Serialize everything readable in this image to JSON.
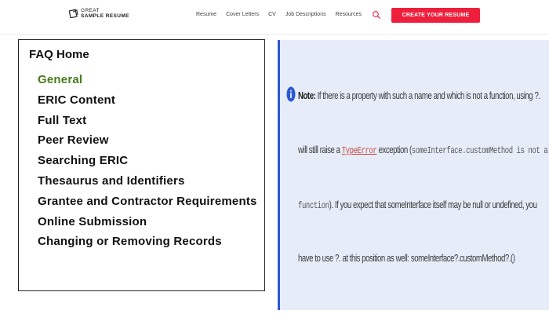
{
  "header": {
    "logo_line1": "GREAT",
    "logo_line2": "SAMPLE RESUME",
    "nav": [
      "Resume",
      "Cover Letters",
      "CV",
      "Job Descriptions",
      "Resources"
    ],
    "cta_label": "CREATE YOUR RESUME",
    "accent_color": "#ee1f3c"
  },
  "faq": {
    "title": "FAQ Home",
    "items": [
      "General",
      "ERIC Content",
      "Full Text",
      "Peer Review",
      "Searching ERIC",
      "Thesaurus and Identifiers",
      "Grantee and Contractor Requirements",
      "Online Submission",
      "Changing or Removing Records"
    ],
    "active_index": 0,
    "active_color": "#4a7a1a"
  },
  "note": {
    "label": "Note:",
    "l1": " If there is a property with such a name and which is not a function, using ?.",
    "l2a": "will still raise a ",
    "l2_code_error": "TypeError",
    "l2b": " exception (",
    "l2_code": "someInterface.customMethod is not a",
    "l3_code": "function",
    "l3b": "). If you expect that someInterface itself may be null or undefined, you",
    "l4": "have to use ?. at this position as well: someInterface?.customMethod?.()",
    "border_color": "#2b59d1",
    "background_color": "#e7ecf9"
  }
}
